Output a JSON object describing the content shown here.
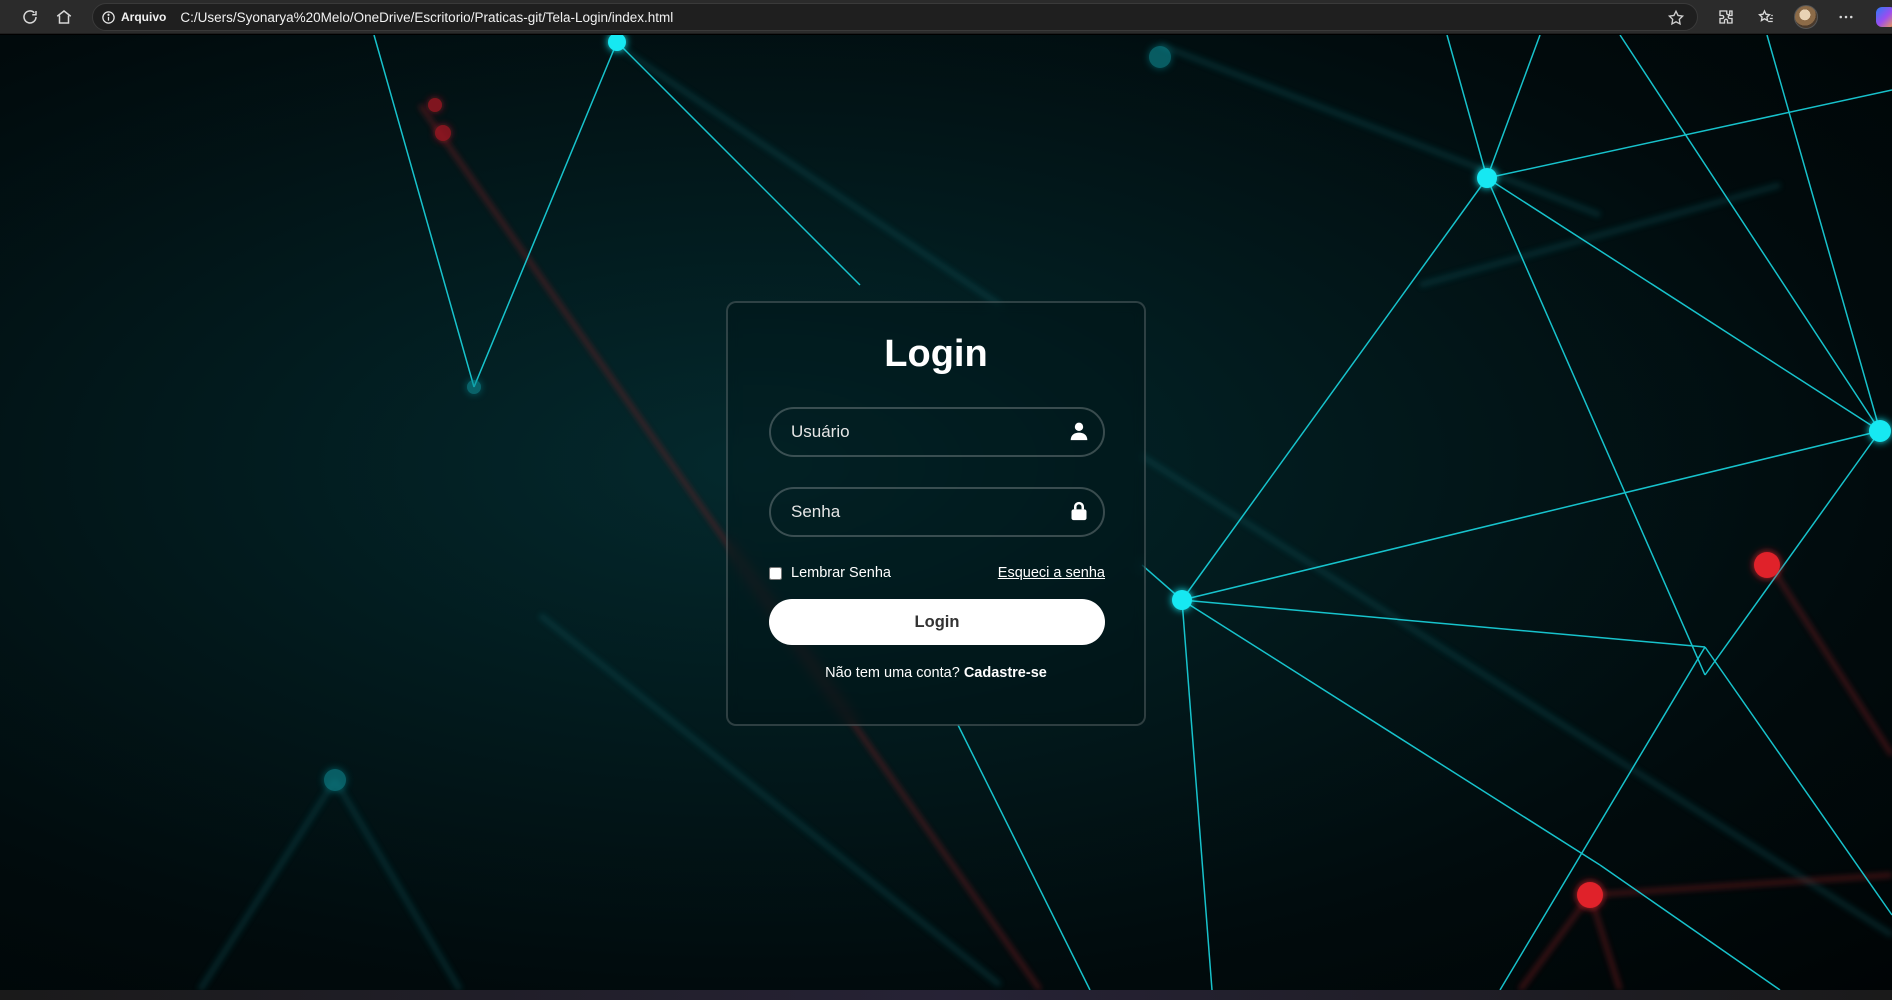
{
  "browser": {
    "site_label": "Arquivo",
    "url": "C:/Users/Syonarya%20Melo/OneDrive/Escritorio/Praticas-git/Tela-Login/index.html",
    "icons": [
      "reload-icon",
      "home-icon",
      "info-icon",
      "favorite-star-icon",
      "extensions-icon",
      "favorites-icon",
      "profile-avatar",
      "more-icon",
      "copilot-icon"
    ]
  },
  "login": {
    "title": "Login",
    "username_placeholder": "Usuário",
    "password_placeholder": "Senha",
    "remember_label": "Lembrar Senha",
    "forgot_link": "Esqueci a senha",
    "button_label": "Login",
    "register_prompt": "Não tem uma conta?",
    "register_link": "Cadastre-se"
  },
  "colors": {
    "accent_cyan": "#00e5f0",
    "accent_red": "#e0202a",
    "card_border": "rgba(255,255,255,0.18)",
    "button_bg": "#ffffff"
  }
}
